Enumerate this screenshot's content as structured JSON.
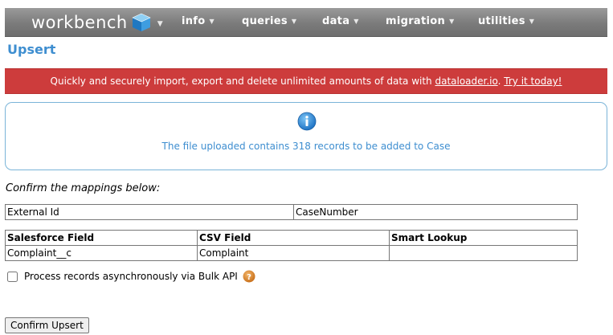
{
  "nav": {
    "brand": "workbench",
    "items": [
      {
        "label": "info"
      },
      {
        "label": "queries"
      },
      {
        "label": "data"
      },
      {
        "label": "migration"
      },
      {
        "label": "utilities"
      }
    ]
  },
  "page": {
    "title": "Upsert"
  },
  "promo": {
    "text": "Quickly and securely import, export and delete unlimited amounts of data with ",
    "link1": "dataloader.io",
    "sep": ". ",
    "link2": "Try it today!"
  },
  "info": {
    "message": "The file uploaded contains 318 records to be added to Case"
  },
  "mapping": {
    "instruction": "Confirm the mappings below:",
    "external_id": {
      "label": "External Id",
      "value": "CaseNumber"
    },
    "headers": [
      "Salesforce Field",
      "CSV Field",
      "Smart Lookup"
    ],
    "rows": [
      [
        "Complaint__c",
        "Complaint",
        ""
      ]
    ]
  },
  "async": {
    "label": "Process records asynchronously via Bulk API",
    "checked": false
  },
  "actions": {
    "confirm": "Confirm Upsert"
  },
  "colors": {
    "accent": "#3e8ed0",
    "promo_bg": "#cd3c3c",
    "info_border": "#7ab4d8",
    "help": "#d9822b"
  }
}
